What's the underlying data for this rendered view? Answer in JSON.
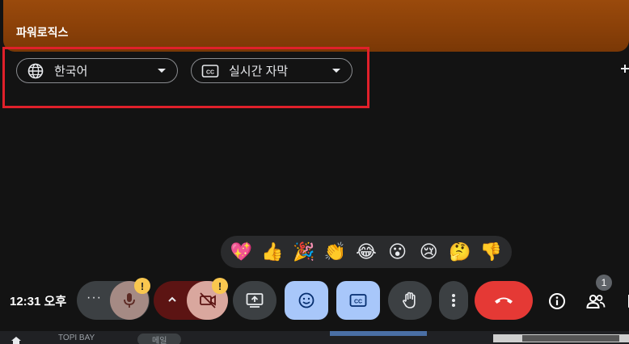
{
  "participant": {
    "name": "파워로직스"
  },
  "caption_settings": {
    "language": {
      "label": "한국어",
      "icon": "globe-icon"
    },
    "captions": {
      "label": "실시간 자막",
      "icon": "closed-caption-icon"
    }
  },
  "reactions": [
    {
      "name": "sparkling-heart",
      "glyph": "💖"
    },
    {
      "name": "thumbs-up",
      "glyph": "👍"
    },
    {
      "name": "party-popper",
      "glyph": "🎉"
    },
    {
      "name": "clapping-hands",
      "glyph": "👏"
    },
    {
      "name": "tears-of-joy",
      "glyph": "😂"
    },
    {
      "name": "surprised",
      "glyph": "😮"
    },
    {
      "name": "crying",
      "glyph": "😢"
    },
    {
      "name": "thinking",
      "glyph": "🤔"
    },
    {
      "name": "thumbs-down",
      "glyph": "👎"
    }
  ],
  "status": {
    "time": "12:31 오후"
  },
  "controls": {
    "more_options_label": "···",
    "mic_warning": "!",
    "camera_warning": "!",
    "participants_count": "1"
  },
  "taskbar": {
    "item1": "TOPI BAY",
    "item2": "메일"
  },
  "colors": {
    "accent_blue": "#a8c7fa",
    "end_call_red": "#e53935",
    "warning_yellow": "#f9c74f",
    "highlight_red": "#e0202a"
  }
}
